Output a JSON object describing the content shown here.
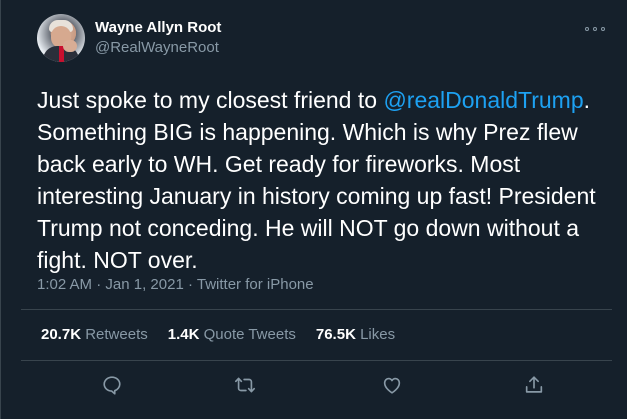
{
  "user": {
    "display_name": "Wayne Allyn Root",
    "handle": "@RealWayneRoot"
  },
  "tweet": {
    "text_before": "Just spoke to my closest friend to ",
    "mention": "@realDonaldTrump",
    "text_after": ". Something BIG is happening. Which is why Prez flew back early to WH. Get ready for fireworks. Most interesting January in history coming up fast! President Trump not conceding. He will NOT go down without a fight. NOT over.",
    "time": "1:02 AM",
    "date": "Jan 1, 2021",
    "source": "Twitter for iPhone",
    "separator": "·"
  },
  "stats": {
    "retweets_count": "20.7K",
    "retweets_label": "Retweets",
    "quote_count": "1.4K",
    "quote_label": "Quote Tweets",
    "likes_count": "76.5K",
    "likes_label": "Likes"
  },
  "icons": {
    "more": "more-options-icon",
    "reply": "reply-icon",
    "retweet": "retweet-icon",
    "like": "like-icon",
    "share": "share-icon"
  },
  "colors": {
    "background": "#15202b",
    "text": "#ffffff",
    "secondary": "#8899a6",
    "link": "#1da1f2",
    "border": "#38444d"
  }
}
